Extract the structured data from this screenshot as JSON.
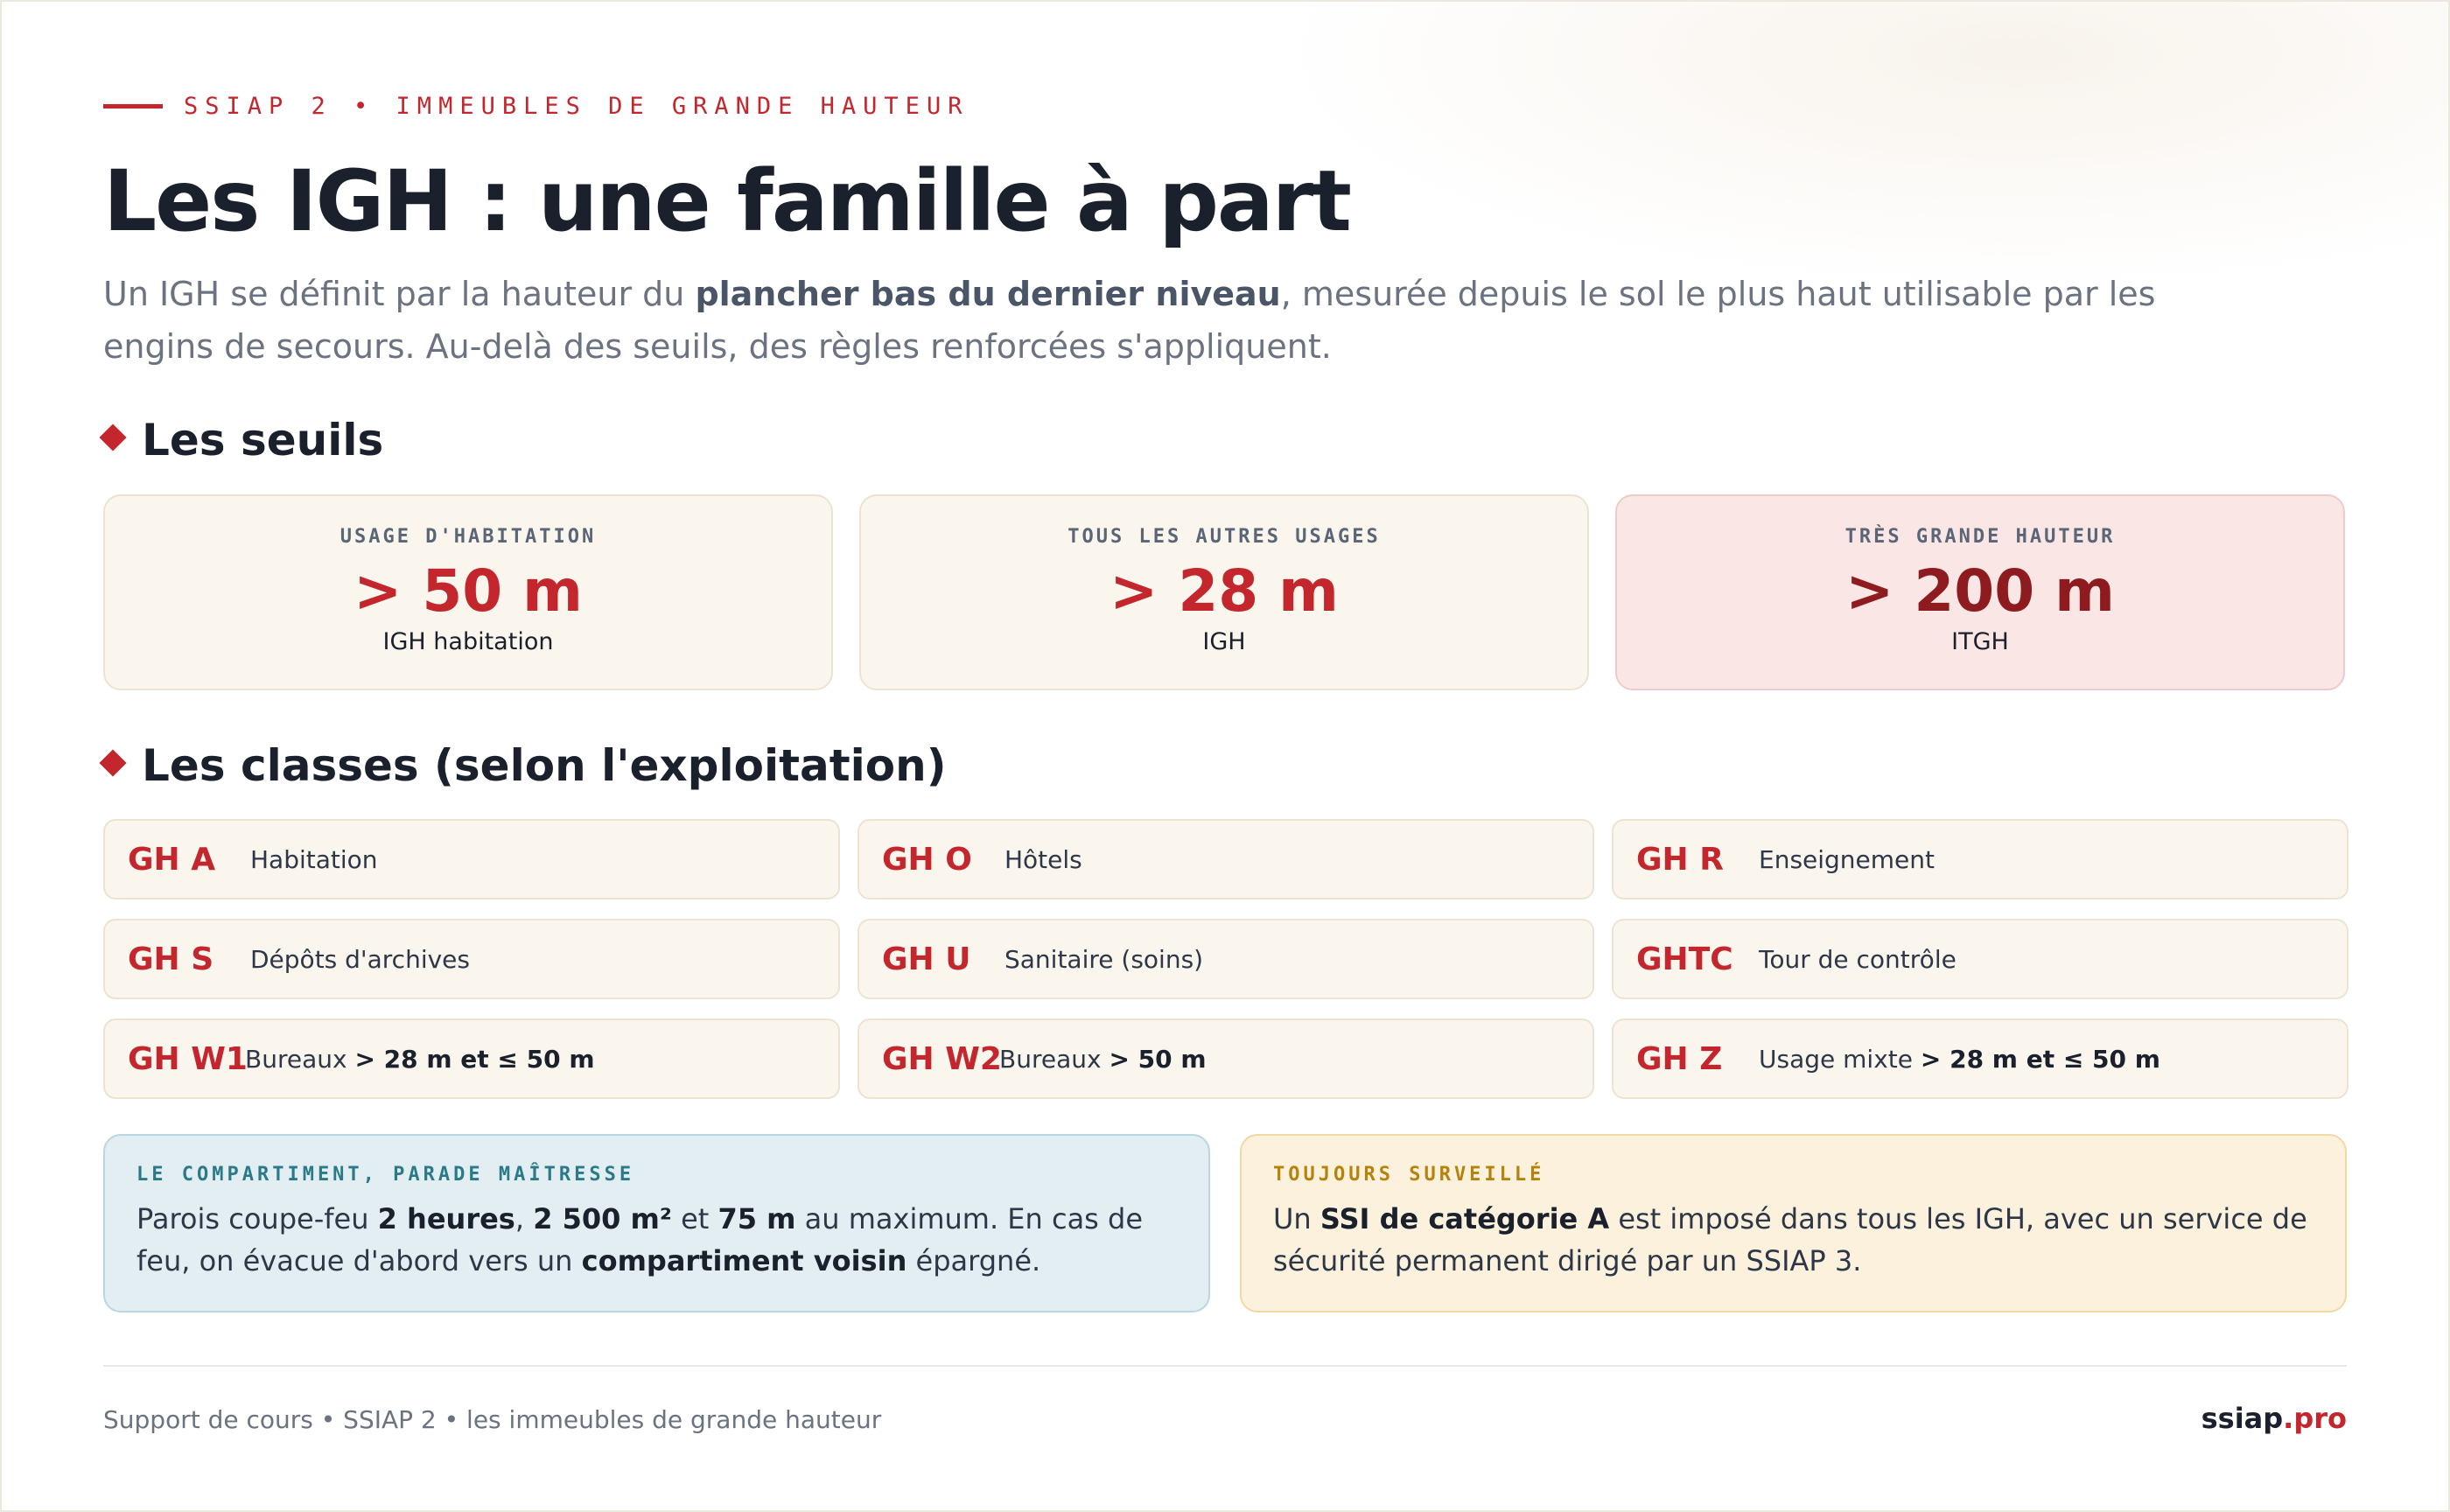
{
  "header": {
    "kicker": "SSIAP 2 • IMMEUBLES DE GRANDE HAUTEUR",
    "title": "Les IGH : une famille à part",
    "lead": {
      "p1": "Un IGH se définit par la hauteur du ",
      "b1": "plancher bas du dernier niveau",
      "p2": ", mesurée depuis le sol le plus haut utilisable par les engins de secours. Au-delà des seuils, des règles renforcées s'appliquent."
    }
  },
  "thresholds": {
    "heading": "Les seuils",
    "items": [
      {
        "label": "USAGE D'HABITATION",
        "value": "> 50 m",
        "sub": "IGH habitation"
      },
      {
        "label": "TOUS LES AUTRES USAGES",
        "value": "> 28 m",
        "sub": "IGH"
      },
      {
        "label": "TRÈS GRANDE HAUTEUR",
        "value": "> 200 m",
        "sub": "ITGH"
      }
    ]
  },
  "classes": {
    "heading": "Les classes (selon l'exploitation)",
    "items": [
      {
        "code": "GH A",
        "desc": "Habitation",
        "bold": ""
      },
      {
        "code": "GH O",
        "desc": "Hôtels",
        "bold": ""
      },
      {
        "code": "GH R",
        "desc": "Enseignement",
        "bold": ""
      },
      {
        "code": "GH S",
        "desc": "Dépôts d'archives",
        "bold": ""
      },
      {
        "code": "GH U",
        "desc": "Sanitaire (soins)",
        "bold": ""
      },
      {
        "code": "GHTC",
        "desc": "Tour de contrôle",
        "bold": ""
      },
      {
        "code": "GH W1",
        "desc": "Bureaux ",
        "bold": "> 28 m et ≤ 50 m"
      },
      {
        "code": "GH W2",
        "desc": "Bureaux ",
        "bold": "> 50 m"
      },
      {
        "code": "GH Z",
        "desc": "Usage mixte ",
        "bold": "> 28 m et ≤ 50 m"
      }
    ]
  },
  "callouts": {
    "compartment": {
      "label": "LE COMPARTIMENT, PARADE MAÎTRESSE",
      "t1": "Parois coupe-feu ",
      "b1": "2 heures",
      "t2": ", ",
      "b2": "2 500 m²",
      "t3": " et ",
      "b3": "75 m",
      "t4": " au maximum. En cas de feu, on évacue d'abord vers un ",
      "b4": "compartiment voisin",
      "t5": " épargné."
    },
    "surveillance": {
      "label": "TOUJOURS SURVEILLÉ",
      "t1": "Un ",
      "b1": "SSI de catégorie A",
      "t2": " est imposé dans tous les IGH, avec un service de sécurité permanent dirigé par un SSIAP 3."
    }
  },
  "footer": {
    "left": "Support de cours • SSIAP 2 • les immeubles de grande hauteur",
    "brand_main": "ssiap",
    "brand_accent": ".pro"
  },
  "colors": {
    "accent": "#c4262e",
    "dark_accent": "#8e1b1f",
    "card_bg": "#faf6ee",
    "alert_bg": "#fbe6e6",
    "info_bg": "#e3eef2",
    "warn_bg": "#fcf1dc"
  }
}
